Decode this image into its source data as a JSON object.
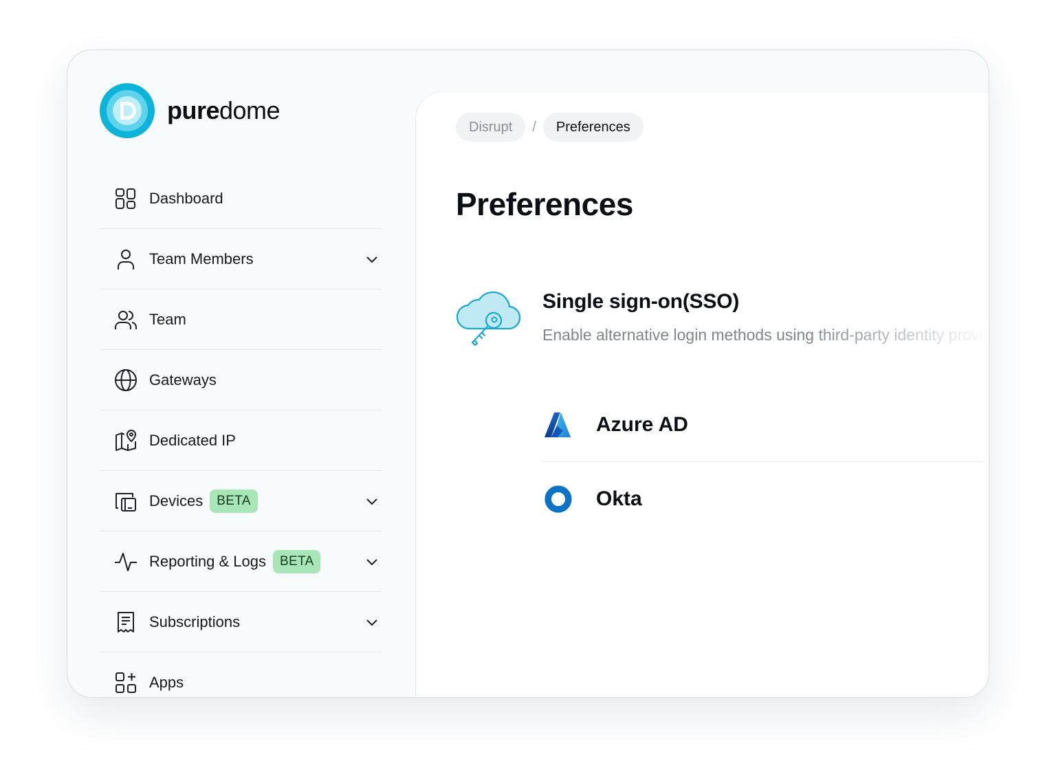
{
  "app": {
    "brand_bold": "pure",
    "brand_light": "dome",
    "accent": "#0bb4d8"
  },
  "sidebar": {
    "items": [
      {
        "label": "Dashboard",
        "icon": "dashboard-icon",
        "has_chevron": false
      },
      {
        "label": "Team Members",
        "icon": "user-icon",
        "has_chevron": true
      },
      {
        "label": "Team",
        "icon": "users-icon",
        "has_chevron": false
      },
      {
        "label": "Gateways",
        "icon": "globe-icon",
        "has_chevron": false
      },
      {
        "label": "Dedicated IP",
        "icon": "map-pin-icon",
        "has_chevron": false
      },
      {
        "label": "Devices",
        "icon": "devices-icon",
        "has_chevron": true,
        "badge": "BETA"
      },
      {
        "label": "Reporting & Logs",
        "icon": "activity-icon",
        "has_chevron": true,
        "badge": "BETA"
      },
      {
        "label": "Subscriptions",
        "icon": "receipt-icon",
        "has_chevron": true
      },
      {
        "label": "Apps",
        "icon": "apps-add-icon",
        "has_chevron": false
      }
    ],
    "badge_color": "#a8e6b8"
  },
  "breadcrumb": {
    "parent": "Disrupt",
    "separator": "/",
    "current": "Preferences"
  },
  "page": {
    "title": "Preferences"
  },
  "sso": {
    "title": "Single sign-on(SSO)",
    "description": "Enable alternative login methods using third-party identity providers",
    "icon": "cloud-key-icon",
    "providers": [
      {
        "name": "Azure AD",
        "icon": "azure-icon"
      },
      {
        "name": "Okta",
        "icon": "okta-icon"
      }
    ]
  }
}
